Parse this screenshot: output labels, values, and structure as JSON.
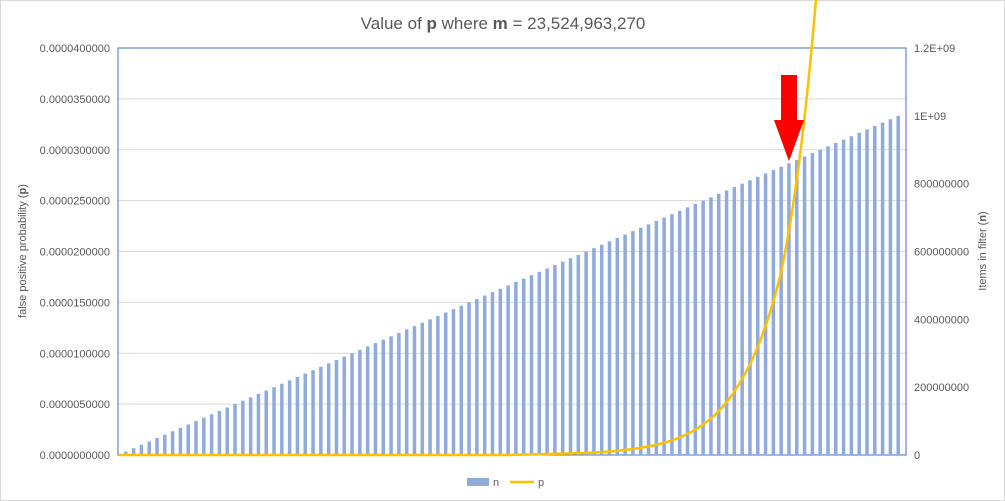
{
  "chart_data": {
    "type": "bar+line",
    "title": {
      "prefix": "Value of ",
      "var1": "p",
      "middle": " where ",
      "var2": "m",
      "suffix": " = 23,524,963,270"
    },
    "y_left": {
      "label_prefix": "false positive probability (",
      "label_var": "p",
      "label_suffix": ")",
      "ticks": [
        "0.0000000000",
        "0.0000050000",
        "0.0000100000",
        "0.0000150000",
        "0.0000200000",
        "0.0000250000",
        "0.0000300000",
        "0.0000350000",
        "0.0000400000"
      ],
      "range": [
        0,
        4e-06
      ]
    },
    "y_right": {
      "label_prefix": "Items in filter (",
      "label_var": "n",
      "label_suffix": ")",
      "ticks": [
        "0",
        "200000000",
        "400000000",
        "600000000",
        "800000000",
        "1E+09",
        "1.2E+09"
      ],
      "range": [
        0,
        1200000000
      ]
    },
    "series": [
      {
        "name": "n",
        "type": "bar",
        "axis": "right",
        "color": "#8faadc",
        "count": 100,
        "start": 10000000,
        "step": 10000000
      },
      {
        "name": "p",
        "type": "line",
        "axis": "left",
        "color": "#ffc000",
        "points": [
          {
            "n": 0,
            "p": 0
          },
          {
            "n": 500000000,
            "p": 0
          },
          {
            "n": 600000000,
            "p": 2e-08
          },
          {
            "n": 650000000,
            "p": 5e-08
          },
          {
            "n": 700000000,
            "p": 1.2e-07
          },
          {
            "n": 750000000,
            "p": 3e-07
          },
          {
            "n": 800000000,
            "p": 7.5e-07
          },
          {
            "n": 850000000,
            "p": 1.8e-06
          },
          {
            "n": 900000000,
            "p": 5e-06
          },
          {
            "n": 950000000,
            "p": 1.3e-05
          },
          {
            "n": 1000000000,
            "p": 3.35e-05
          }
        ]
      }
    ],
    "annotation": {
      "type": "arrow",
      "color": "#ff0000",
      "at_n": 860000000
    },
    "legend": {
      "placement": "bottom",
      "items": [
        "n",
        "p"
      ]
    },
    "grid": true
  }
}
